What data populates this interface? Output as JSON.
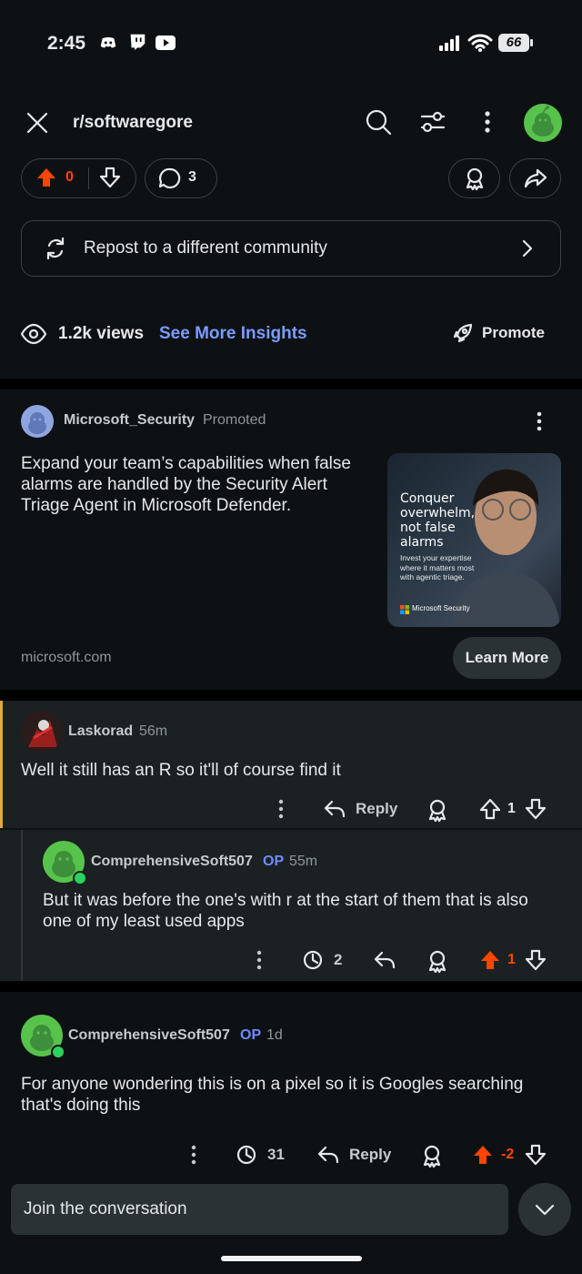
{
  "status_bar": {
    "time": "2:45",
    "battery": "66"
  },
  "header": {
    "subreddit": "r/softwaregore"
  },
  "post_actions": {
    "vote_count": "0",
    "comment_count": "3"
  },
  "repost": {
    "label": "Repost to a different community"
  },
  "insights": {
    "views": "1.2k views",
    "see_more": "See More Insights",
    "promote": "Promote"
  },
  "ad": {
    "author": "Microsoft_Security",
    "tag": "Promoted",
    "body": "Expand your team’s capabilities when false alarms are handled by the Security Alert Triage Agent in Microsoft Defender.",
    "image_headline": "Conquer overwhelm, not false alarms",
    "image_sub": "Invest your expertise where it matters most with agentic triage.",
    "image_brand": "Microsoft Security",
    "domain": "microsoft.com",
    "cta": "Learn More"
  },
  "comments": [
    {
      "author": "Laskorad",
      "time": "56m",
      "body": "Well it still has an R so it'll of course find it",
      "reply": "Reply",
      "votes": "1"
    },
    {
      "author": "ComprehensiveSoft507",
      "op": "OP",
      "time": "55m",
      "body": "But it was before the one's with r at the start of them that is also one of my least used apps",
      "awards": "2",
      "votes": "1"
    },
    {
      "author": "ComprehensiveSoft507",
      "op": "OP",
      "time": "1d",
      "body": "For anyone wondering this is on a pixel so it is Googles searching that's doing this",
      "awards": "31",
      "reply": "Reply",
      "votes": "-2"
    }
  ],
  "composer": {
    "placeholder": "Join the conversation"
  },
  "colors": {
    "accent_blue": "#7a9cff",
    "upvote": "#ff4500",
    "op_blue": "#6e8bff",
    "background": "#0e1113",
    "card": "#1b2023"
  }
}
